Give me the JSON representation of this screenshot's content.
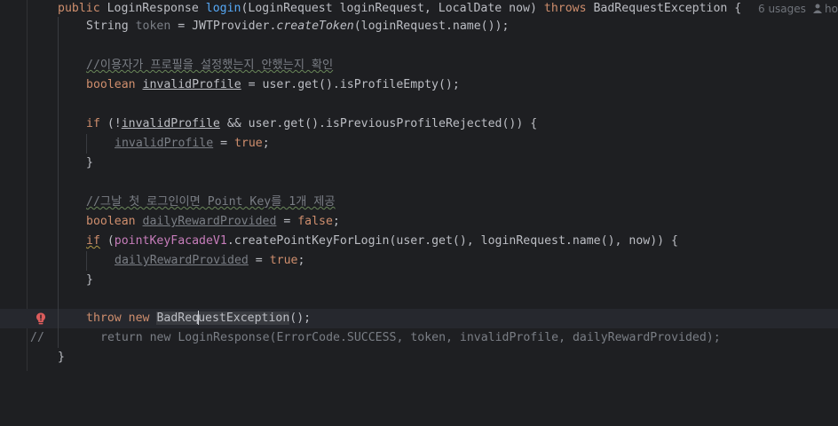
{
  "signature": {
    "kw_public": "public",
    "type_return": "LoginResponse",
    "method_name": "login",
    "params": "(LoginRequest loginRequest, LocalDate now)",
    "kw_throws": "throws",
    "exception_type": "BadRequestException {",
    "usages_hint": "6 usages",
    "author_hint": "ho"
  },
  "lines": {
    "l1_type": "String",
    "l1_var": "token",
    "l1_rest_a": " = JWTProvider.",
    "l1_call": "createToken",
    "l1_rest_b": "(loginRequest.name());",
    "l3_comment": "//이용자가 프로필을 설정했는지 안했는지 확인",
    "l4_kw": "boolean",
    "l4_var": "invalidProfile",
    "l4_rest": " = user.get().isProfileEmpty();",
    "l6_kw": "if",
    "l6_a": " (!",
    "l6_var": "invalidProfile",
    "l6_b": " && user.get().isPreviousProfileRejected()) {",
    "l7_var": "invalidProfile",
    "l7_eq": " = ",
    "l7_val": "true",
    "l7_end": ";",
    "l8_brace": "}",
    "l10_comment": "//그날 첫 로그인이면 Point Key를 1개 제공",
    "l11_kw": "boolean",
    "l11_var": "dailyRewardProvided",
    "l11_eq": " = ",
    "l11_val": "false",
    "l11_end": ";",
    "l12_kw": "if",
    "l12_a": " (",
    "l12_field": "pointKeyFacadeV1",
    "l12_b": ".createPointKeyForLogin(user.get(), loginRequest.name(), now)) {",
    "l13_var": "dailyRewardProvided",
    "l13_eq": " = ",
    "l13_val": "true",
    "l13_end": ";",
    "l14_brace": "}",
    "l16_kw1": "throw",
    "l16_kw2": "new",
    "l16_cls_a": "BadReq",
    "l16_cls_b": "uestException",
    "l16_end": "();",
    "l17_marker": "//",
    "l17_code": "return new LoginResponse(ErrorCode.SUCCESS, token, invalidProfile, dailyRewardProvided);",
    "l18_brace": "}"
  },
  "colors": {
    "background": "#1e1f22",
    "keyword": "#cf8e6d",
    "function": "#56a8f5",
    "comment": "#7a7e85",
    "field": "#c77dbb",
    "default": "#bcbec4"
  },
  "icons": [
    "user-icon",
    "error-bulb-icon"
  ]
}
